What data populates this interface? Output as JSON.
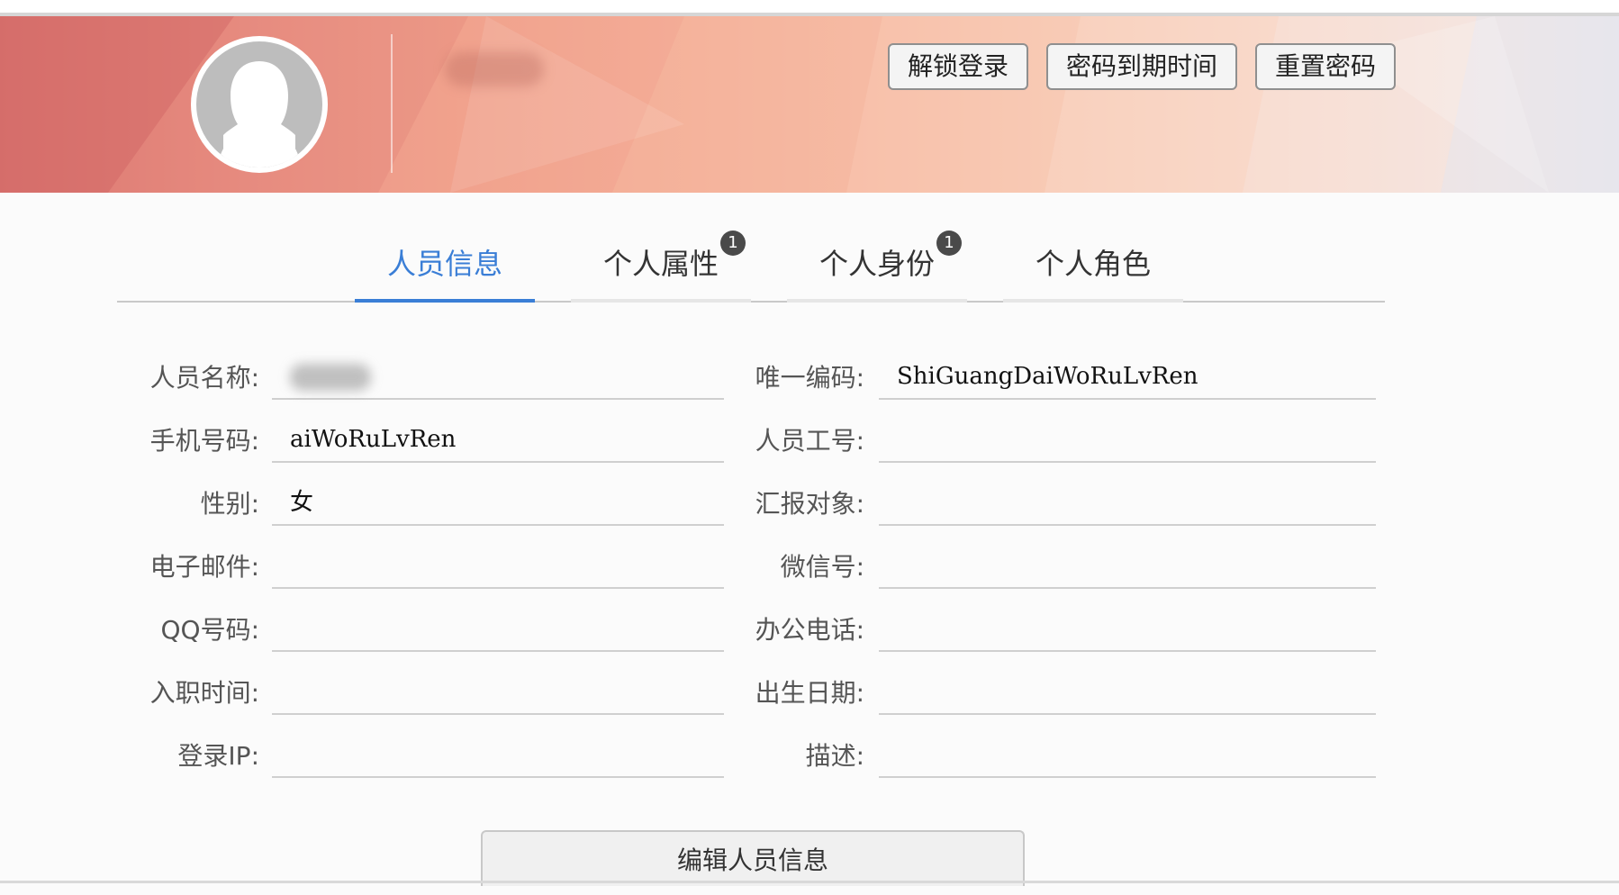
{
  "header": {
    "buttons": {
      "unlock_login": "解锁登录",
      "password_expiry": "密码到期时间",
      "reset_password": "重置密码"
    }
  },
  "tabs": [
    {
      "label": "人员信息",
      "badge": ""
    },
    {
      "label": "个人属性",
      "badge": "1"
    },
    {
      "label": "个人身份",
      "badge": "1"
    },
    {
      "label": "个人角色",
      "badge": ""
    }
  ],
  "form": {
    "left": [
      {
        "label": "人员名称:",
        "value": ""
      },
      {
        "label": "手机号码:",
        "value": "aiWoRuLvRen"
      },
      {
        "label": "性别:",
        "value": "女"
      },
      {
        "label": "电子邮件:",
        "value": ""
      },
      {
        "label": "QQ号码:",
        "value": ""
      },
      {
        "label": "入职时间:",
        "value": ""
      },
      {
        "label": "登录IP:",
        "value": ""
      }
    ],
    "right": [
      {
        "label": "唯一编码:",
        "value": "ShiGuangDaiWoRuLvRen"
      },
      {
        "label": "人员工号:",
        "value": ""
      },
      {
        "label": "汇报对象:",
        "value": ""
      },
      {
        "label": "微信号:",
        "value": ""
      },
      {
        "label": "办公电话:",
        "value": ""
      },
      {
        "label": "出生日期:",
        "value": ""
      },
      {
        "label": "描述:",
        "value": ""
      }
    ]
  },
  "actions": {
    "edit_label": "编辑人员信息"
  },
  "colors": {
    "accent": "#3a7ed6",
    "badge": "#4a4a4a"
  },
  "icons": {
    "avatar": "user-avatar-icon"
  }
}
